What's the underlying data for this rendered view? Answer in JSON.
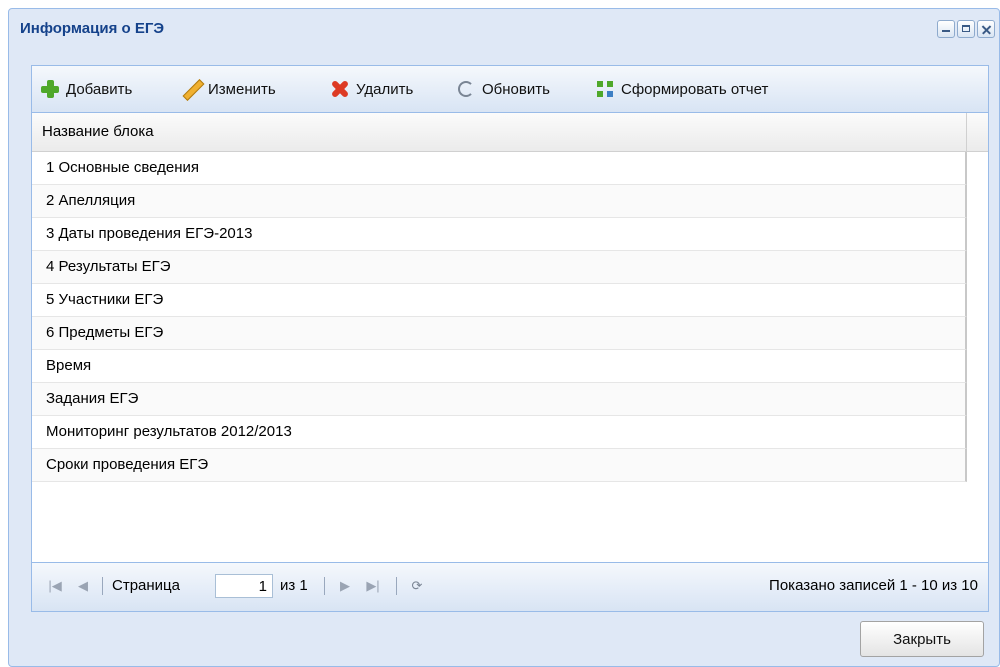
{
  "window": {
    "title": "Информация о ЕГЭ"
  },
  "toolbar": {
    "add_label": "Добавить",
    "edit_label": "Изменить",
    "delete_label": "Удалить",
    "refresh_label": "Обновить",
    "report_label": "Сформировать отчет"
  },
  "grid": {
    "column_header": "Название блока",
    "rows": [
      "1 Основные сведения",
      "2 Апелляция",
      "3 Даты проведения ЕГЭ-2013",
      "4 Результаты ЕГЭ",
      "5 Участники ЕГЭ",
      "6 Предметы ЕГЭ",
      "Время",
      "Задания ЕГЭ",
      "Мониторинг результатов 2012/2013",
      "Сроки проведения ЕГЭ"
    ]
  },
  "pager": {
    "page_label": "Страница",
    "page_value": "1",
    "of_label": "из 1",
    "status": "Показано записей 1 - 10 из 10"
  },
  "footer": {
    "close_label": "Закрыть"
  },
  "icons": {
    "add": "plus-icon",
    "edit": "pencil-icon",
    "delete": "cross-icon",
    "refresh": "refresh-icon",
    "report": "report-icon"
  },
  "colors": {
    "title": "#15428b",
    "window_bg": "#dfe8f6",
    "border": "#99bbe8"
  }
}
